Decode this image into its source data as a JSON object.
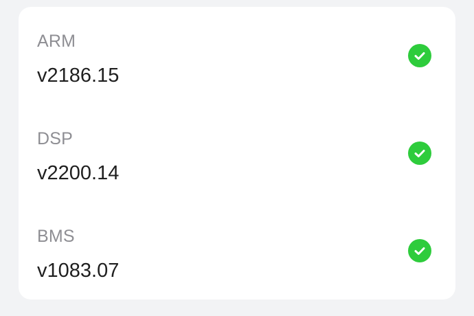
{
  "firmware": {
    "items": [
      {
        "label": "ARM",
        "version": "v2186.15",
        "status": "check-circle-icon",
        "status_color": "#2ecc3c"
      },
      {
        "label": "DSP",
        "version": "v2200.14",
        "status": "check-circle-icon",
        "status_color": "#2ecc3c"
      },
      {
        "label": "BMS",
        "version": "v1083.07",
        "status": "check-circle-icon",
        "status_color": "#2ecc3c"
      }
    ]
  }
}
